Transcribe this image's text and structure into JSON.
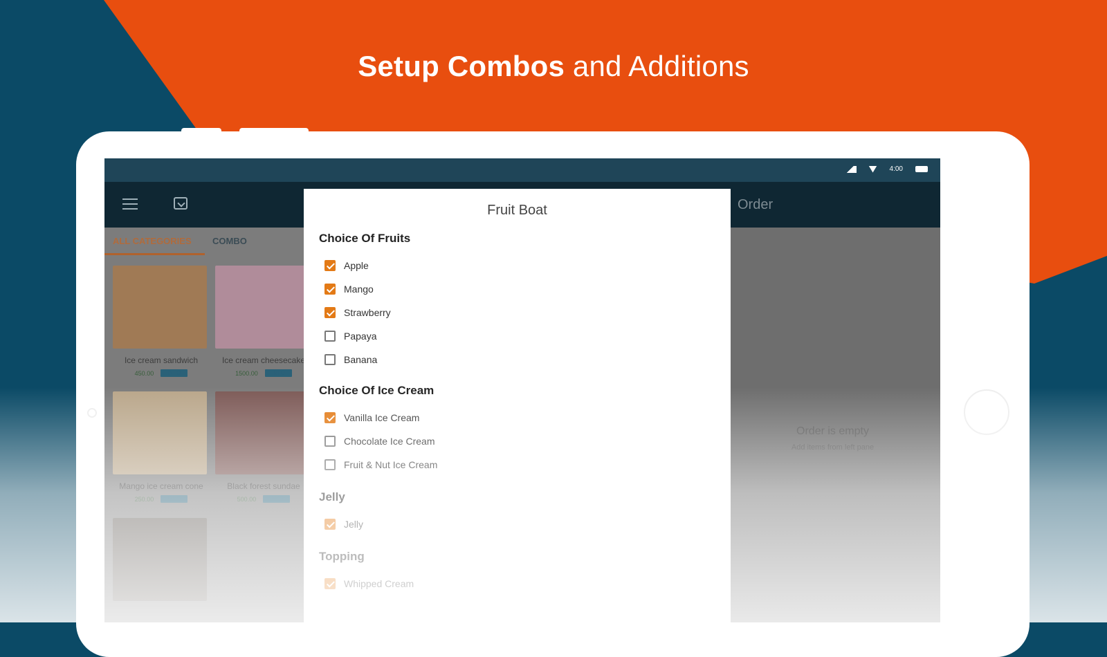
{
  "headline": {
    "bold": "Setup Combos",
    "light": "and Additions"
  },
  "app": {
    "tabs": [
      {
        "label": "ALL CATEGORIES"
      },
      {
        "label": "COMBO"
      }
    ],
    "products": [
      {
        "name": "Ice cream sandwich",
        "price": "450.00",
        "info": "INFO",
        "color": "#a07a55"
      },
      {
        "name": "Ice cream cheesecake",
        "price": "1500.00",
        "info": "INFO",
        "color": "#b08c9a"
      },
      {
        "name": "Mango ice cream cone",
        "price": "250.00",
        "info": "INFO",
        "color": "#b9a68a"
      },
      {
        "name": "Black forest sundae",
        "price": "500.00",
        "info": "INFO",
        "color": "#7d5a57"
      },
      {
        "name": "",
        "price": "",
        "info": "",
        "color": "#5c5650"
      }
    ],
    "order": {
      "title": "Order",
      "empty_title": "Order is empty",
      "empty_hint": "Add items from left pane"
    },
    "status": {
      "clock": "4:00"
    }
  },
  "dialog": {
    "title": "Fruit Boat",
    "groups": [
      {
        "title": "Choice Of Fruits",
        "options": [
          {
            "label": "Apple",
            "checked": true
          },
          {
            "label": "Mango",
            "checked": true
          },
          {
            "label": "Strawberry",
            "checked": true
          },
          {
            "label": "Papaya",
            "checked": false
          },
          {
            "label": "Banana",
            "checked": false
          }
        ]
      },
      {
        "title": "Choice Of Ice Cream",
        "options": [
          {
            "label": "Vanilla Ice Cream",
            "checked": true
          },
          {
            "label": "Chocolate Ice Cream",
            "checked": false
          },
          {
            "label": "Fruit & Nut Ice Cream",
            "checked": false
          }
        ]
      },
      {
        "title": "Jelly",
        "options": [
          {
            "label": "Jelly",
            "checked": true
          }
        ]
      },
      {
        "title": "Topping",
        "options": [
          {
            "label": "Whipped Cream",
            "checked": true
          }
        ]
      }
    ]
  },
  "colors": {
    "orange": "#e84e0f",
    "teal": "#0b4a66",
    "check": "#e37a16"
  }
}
